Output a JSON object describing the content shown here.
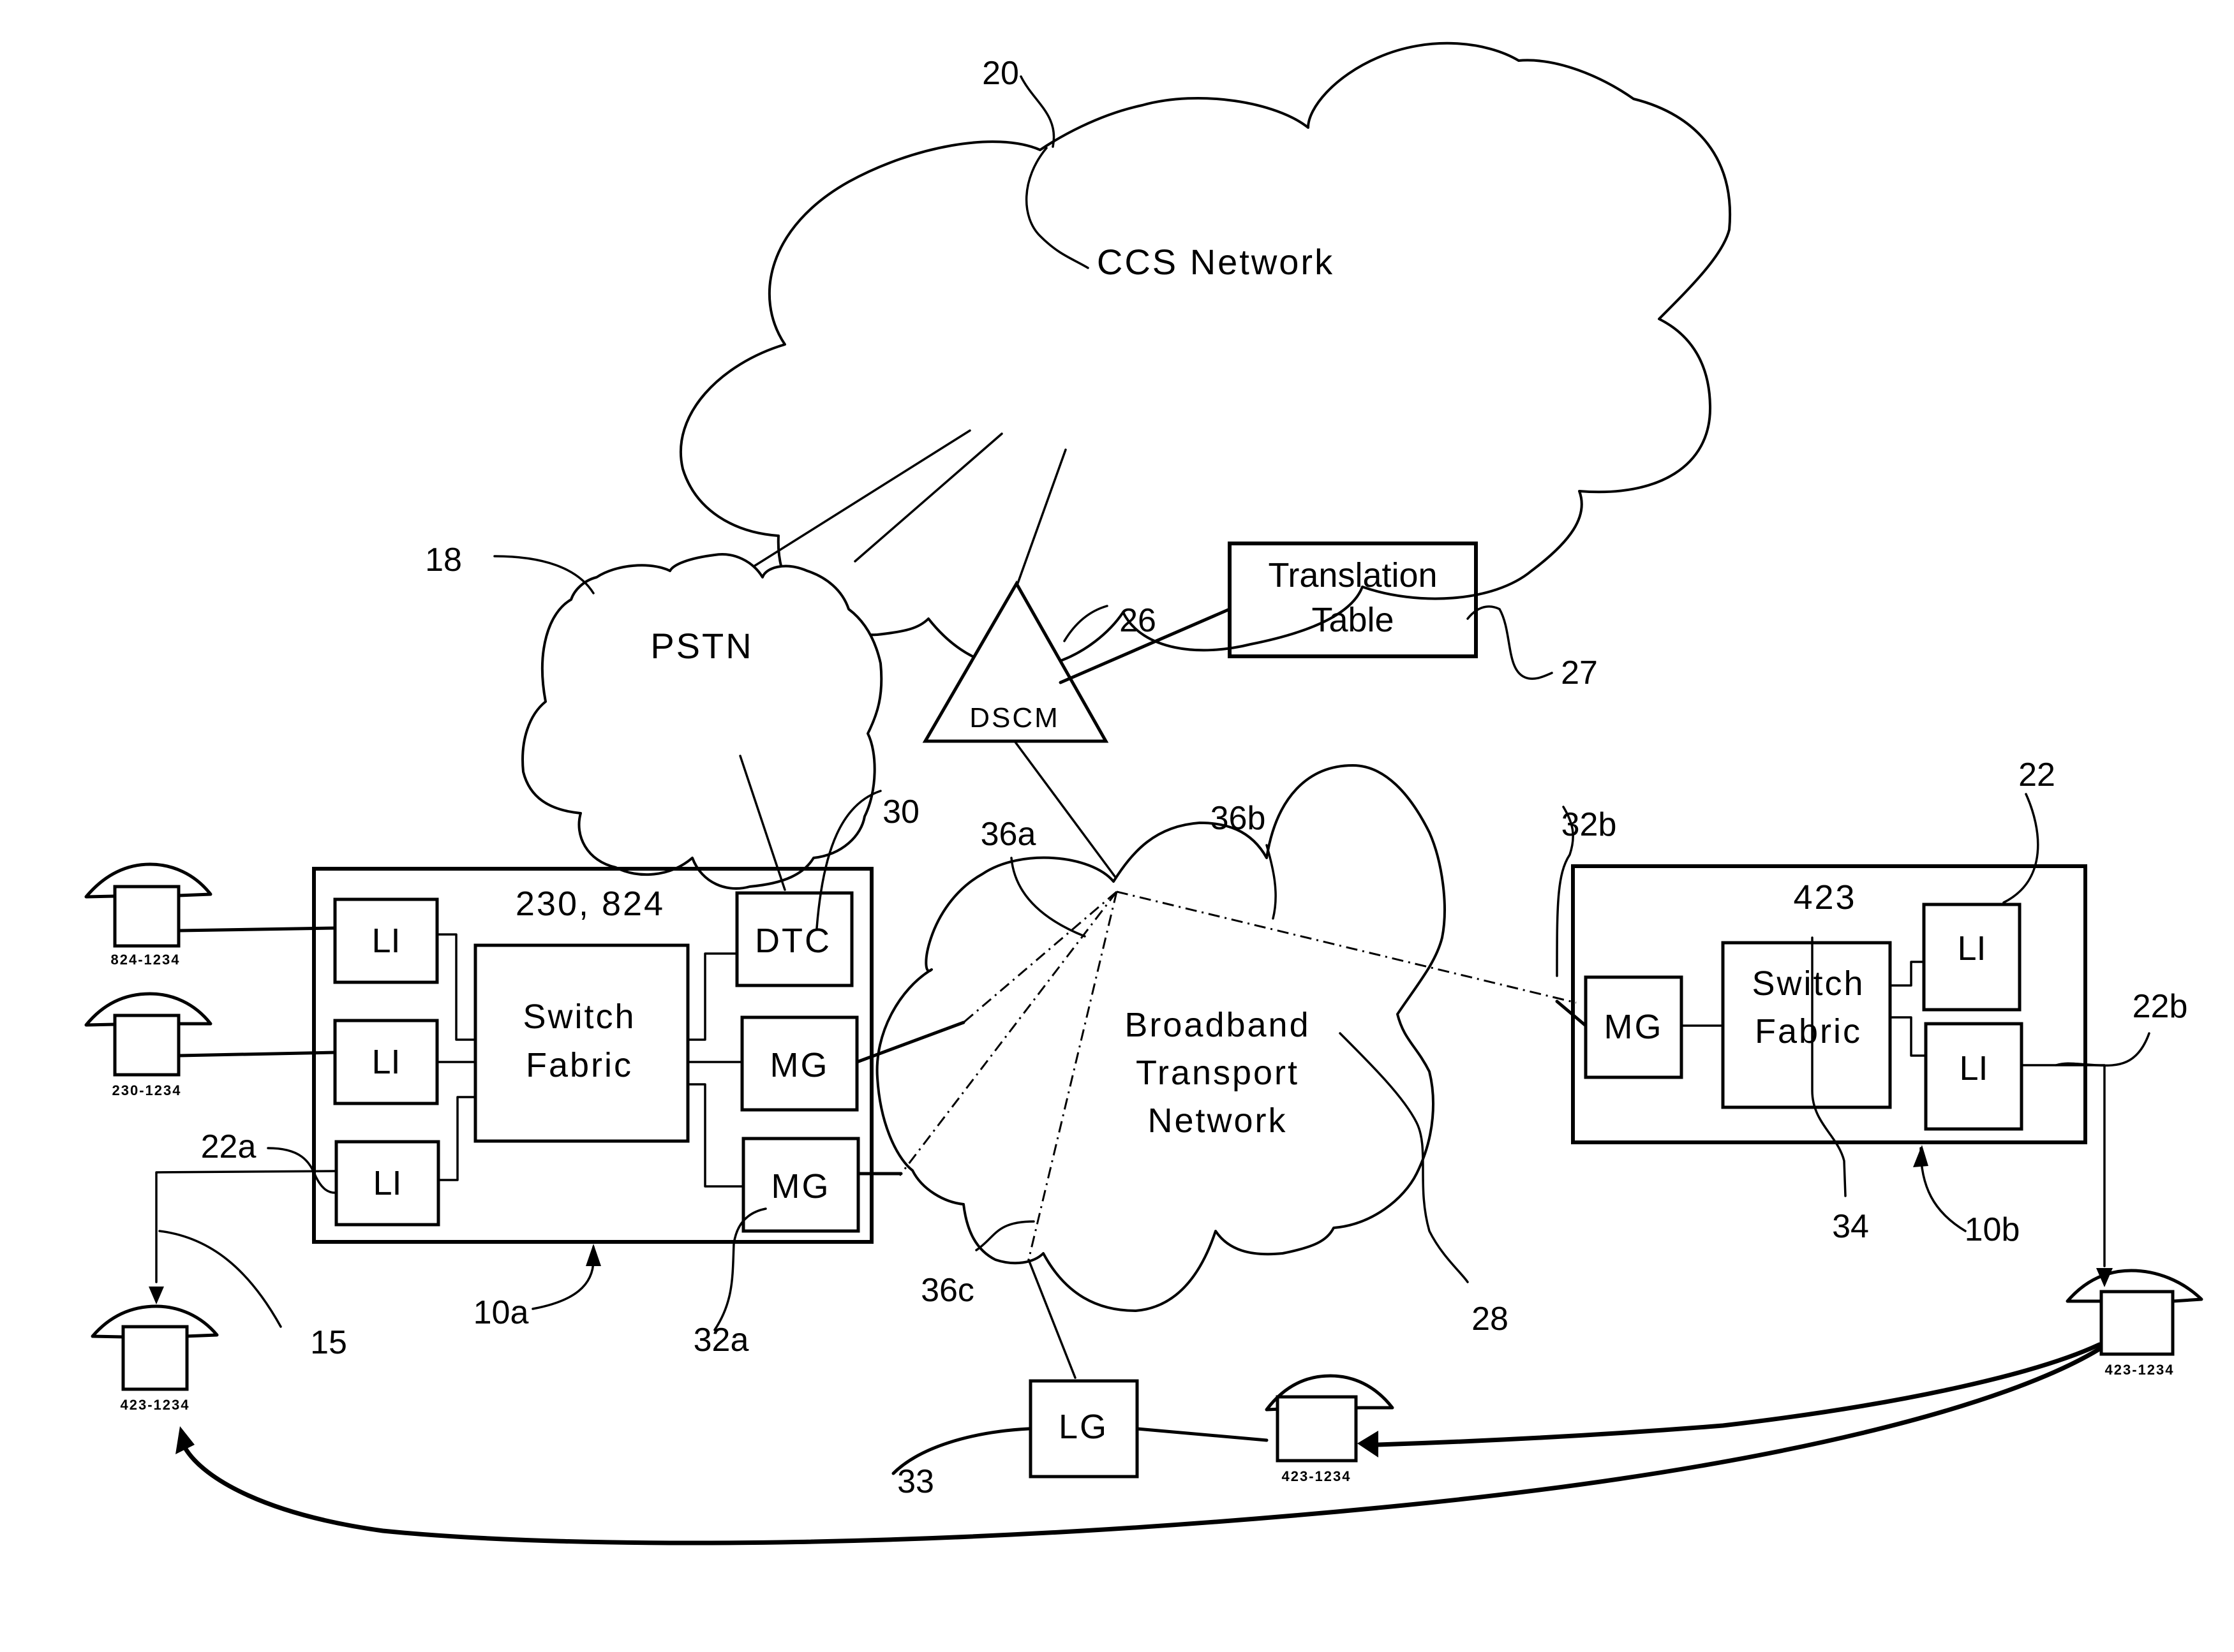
{
  "diagram": {
    "networks": {
      "ccs": {
        "label": "CCS Network",
        "ref": "20"
      },
      "pstn": {
        "label": "PSTN",
        "ref": "18"
      },
      "broadband": {
        "label_line1": "Broadband",
        "label_line2": "Transport",
        "label_line3": "Network",
        "ref": "28"
      }
    },
    "dscm": {
      "label": "DSCM",
      "ref": "26"
    },
    "translation_table": {
      "label_line1": "Translation",
      "label_line2": "Table",
      "ref": "27"
    },
    "switch_a": {
      "ref": "10a",
      "prefixes": "230, 824",
      "fabric_line1": "Switch",
      "fabric_line2": "Fabric",
      "line_interfaces": [
        "LI",
        "LI",
        "LI"
      ],
      "li_ref": "22a",
      "dtc": {
        "label": "DTC",
        "ref": "30"
      },
      "media_gateways": [
        "MG",
        "MG"
      ],
      "mg_ref": "32a"
    },
    "switch_b": {
      "ref": "10b",
      "prefixes": "423",
      "fabric_line1": "Switch",
      "fabric_line2": "Fabric",
      "fabric_ref": "34",
      "line_interfaces": [
        "LI",
        "LI"
      ],
      "li_ref_top": "22",
      "li_ref_bottom": "22b",
      "media_gateway": "MG",
      "mg_ref": "32b"
    },
    "line_gateway": {
      "label": "LG",
      "ref": "33"
    },
    "connection_refs": {
      "a": "36a",
      "b": "36b",
      "c": "36c"
    },
    "call_path_ref": "15",
    "phones": [
      {
        "number": "824-1234"
      },
      {
        "number": "230-1234"
      },
      {
        "number": "423-1234"
      },
      {
        "number": "423-1234"
      },
      {
        "number": "423-1234"
      }
    ]
  }
}
